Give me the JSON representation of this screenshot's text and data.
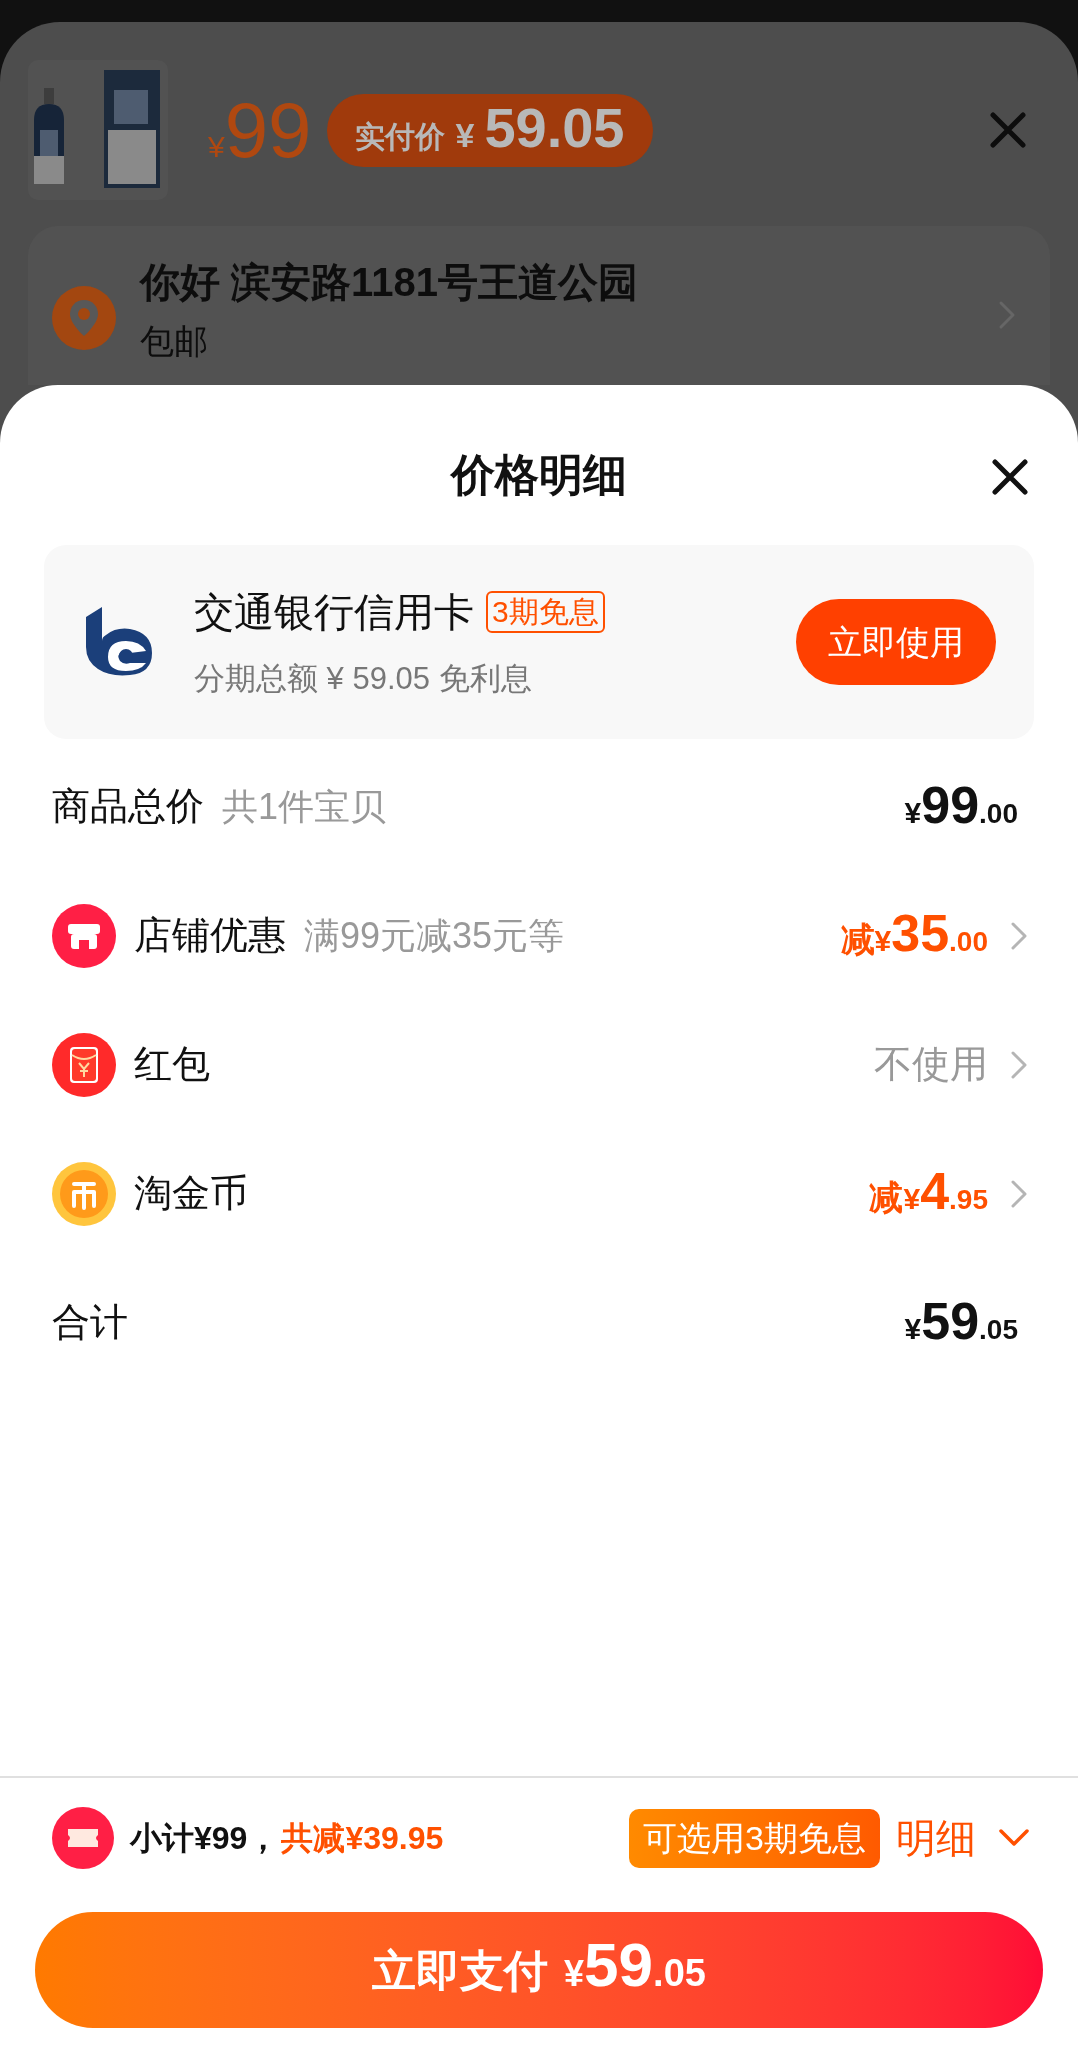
{
  "product": {
    "price_currency": "¥",
    "price": "99",
    "paid_label": "实付价",
    "paid_currency": "¥",
    "paid_amount": "59.05"
  },
  "address": {
    "title": "你好 滨安路1181号王道公园",
    "shipping": "包邮"
  },
  "sheet": {
    "title": "价格明细"
  },
  "bank_offer": {
    "name": "交通银行信用卡",
    "badge": "3期免息",
    "detail": "分期总额 ¥ 59.05 免利息",
    "button": "立即使用"
  },
  "rows": [
    {
      "kind": "plain",
      "label": "商品总价",
      "note": "共1件宝贝",
      "prefix": "",
      "currency": "¥",
      "integer": "99",
      "decimal": ".00"
    },
    {
      "kind": "discount",
      "label": "店铺优惠",
      "note": "满99元减35元等",
      "prefix": "减",
      "currency": "¥",
      "integer": "35",
      "decimal": ".00"
    },
    {
      "kind": "option",
      "label": "红包",
      "value": "不使用"
    },
    {
      "kind": "discount",
      "label": "淘金币",
      "prefix": "减",
      "currency": "¥",
      "integer": "4",
      "decimal": ".95"
    },
    {
      "kind": "plain",
      "label": "合计",
      "prefix": "",
      "currency": "¥",
      "integer": "59",
      "decimal": ".05"
    }
  ],
  "footer": {
    "subtotal": "小计¥99，",
    "saved": "共减¥39.95",
    "tag": "可选用3期免息",
    "details": "明细",
    "pay_label": "立即支付",
    "pay_currency": "¥",
    "pay_integer": "59",
    "pay_decimal": ".05"
  }
}
